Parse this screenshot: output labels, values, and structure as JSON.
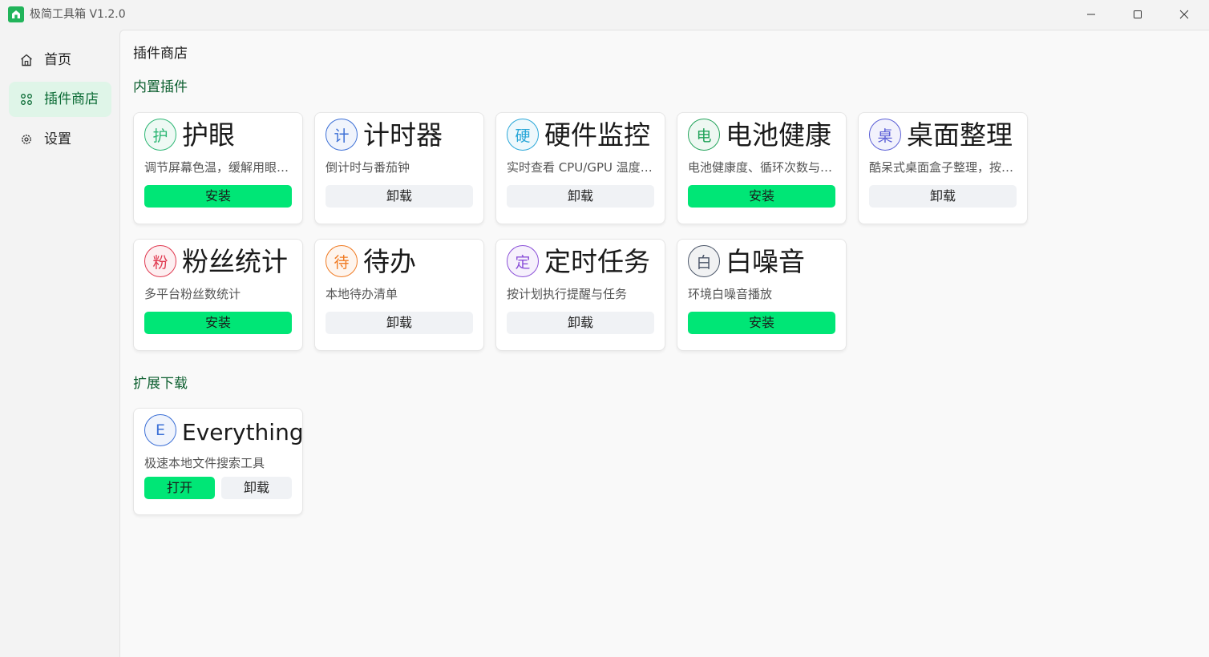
{
  "window": {
    "title": "极简工具箱 V1.2.0"
  },
  "colors": {
    "accent": "#00e676",
    "brand": "#21b45a",
    "section": "#0b5e2e",
    "active_nav_bg": "#dff5e8"
  },
  "sidebar": {
    "items": [
      {
        "label": "首页",
        "icon": "home-icon"
      },
      {
        "label": "插件商店",
        "icon": "grid-icon",
        "active": true
      },
      {
        "label": "设置",
        "icon": "gear-icon"
      }
    ]
  },
  "main": {
    "title": "插件商店",
    "sections": [
      {
        "title": "内置插件",
        "plugins": [
          {
            "badge": "护",
            "name": "护眼",
            "desc": "调节屏幕色温，缓解用眼…",
            "action": "安装",
            "color": "#2bb673"
          },
          {
            "badge": "计",
            "name": "计时器",
            "desc": "倒计时与番茄钟",
            "action": "卸载",
            "color": "#3b6fd6"
          },
          {
            "badge": "硬",
            "name": "硬件监控",
            "desc": "实时查看 CPU/GPU 温度…",
            "action": "卸载",
            "color": "#2aa7d8"
          },
          {
            "badge": "电",
            "name": "电池健康",
            "desc": "电池健康度、循环次数与…",
            "action": "安装",
            "color": "#22a35a"
          },
          {
            "badge": "桌",
            "name": "桌面整理",
            "desc": "酷呆式桌面盒子整理，按…",
            "action": "卸载",
            "color": "#5b5fd6"
          },
          {
            "badge": "粉",
            "name": "粉丝统计",
            "desc": "多平台粉丝数统计",
            "action": "安装",
            "color": "#e0384f"
          },
          {
            "badge": "待",
            "name": "待办",
            "desc": "本地待办清单",
            "action": "卸载",
            "color": "#f07a22"
          },
          {
            "badge": "定",
            "name": "定时任务",
            "desc": "按计划执行提醒与任务",
            "action": "卸载",
            "color": "#8a4fd8"
          },
          {
            "badge": "白",
            "name": "白噪音",
            "desc": "环境白噪音播放",
            "action": "安装",
            "color": "#4a5568"
          }
        ]
      },
      {
        "title": "扩展下载",
        "plugins": [
          {
            "badge": "E",
            "name": "Everything",
            "desc": "极速本地文件搜索工具",
            "open": "打开",
            "action": "卸载",
            "color": "#3b6fd6"
          }
        ]
      }
    ]
  }
}
